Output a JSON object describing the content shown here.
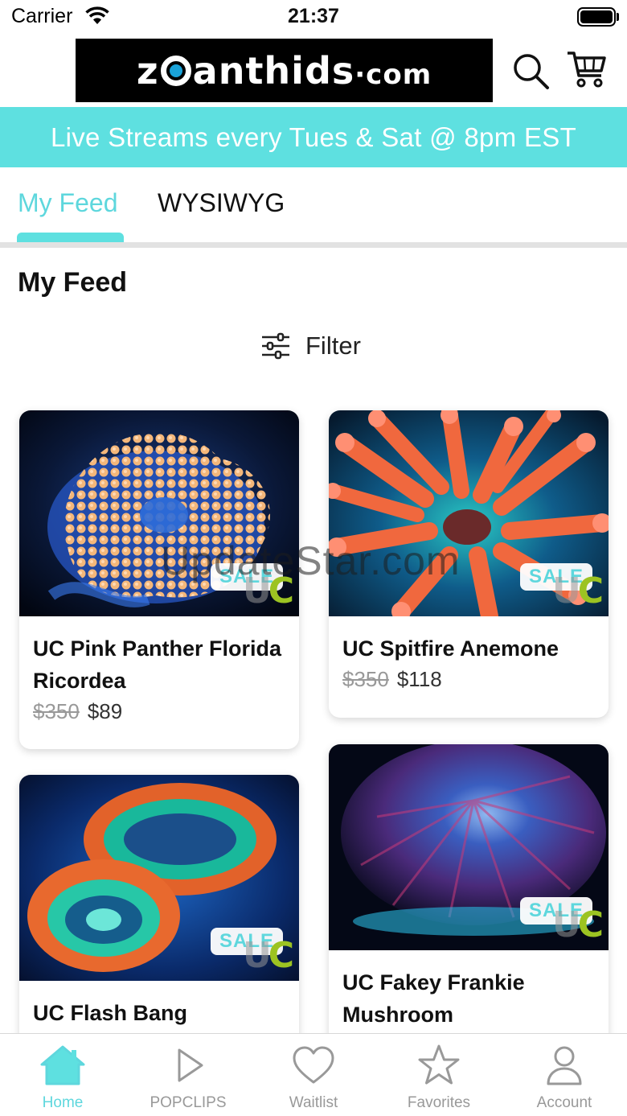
{
  "status_bar": {
    "carrier": "Carrier",
    "time": "21:37"
  },
  "header": {
    "logo_text_before": "z",
    "logo_text_after": "anthids",
    "logo_suffix": "·com"
  },
  "banner": {
    "text": "Live Streams every Tues & Sat @ 8pm EST"
  },
  "tabs": [
    {
      "label": "My Feed",
      "active": true
    },
    {
      "label": "WYSIWYG",
      "active": false
    }
  ],
  "section_title": "My Feed",
  "filter": {
    "label": "Filter",
    "icon": "sliders-icon"
  },
  "products": [
    {
      "name": "UC Pink Panther Florida Ricordea",
      "old_price": "$350",
      "price": "$89",
      "badge": "SALE"
    },
    {
      "name": "UC Spitfire Anemone",
      "old_price": "$350",
      "price": "$118",
      "badge": "SALE"
    },
    {
      "name": "UC Flash Bang",
      "old_price": "",
      "price": "",
      "badge": "SALE"
    },
    {
      "name": "UC Fakey Frankie Mushroom",
      "old_price": "",
      "price": "",
      "badge": "SALE"
    }
  ],
  "watermark": "UpdateStar.com",
  "bottom_nav": [
    {
      "label": "Home",
      "icon": "home-icon",
      "active": true
    },
    {
      "label": "POPCLIPS",
      "icon": "play-icon",
      "active": false
    },
    {
      "label": "Waitlist",
      "icon": "heart-icon",
      "active": false
    },
    {
      "label": "Favorites",
      "icon": "star-icon",
      "active": false
    },
    {
      "label": "Account",
      "icon": "person-icon",
      "active": false
    }
  ],
  "colors": {
    "accent": "#5ee0e0",
    "accent_text": "#5ed7dd",
    "sale_green": "#9cc322"
  }
}
